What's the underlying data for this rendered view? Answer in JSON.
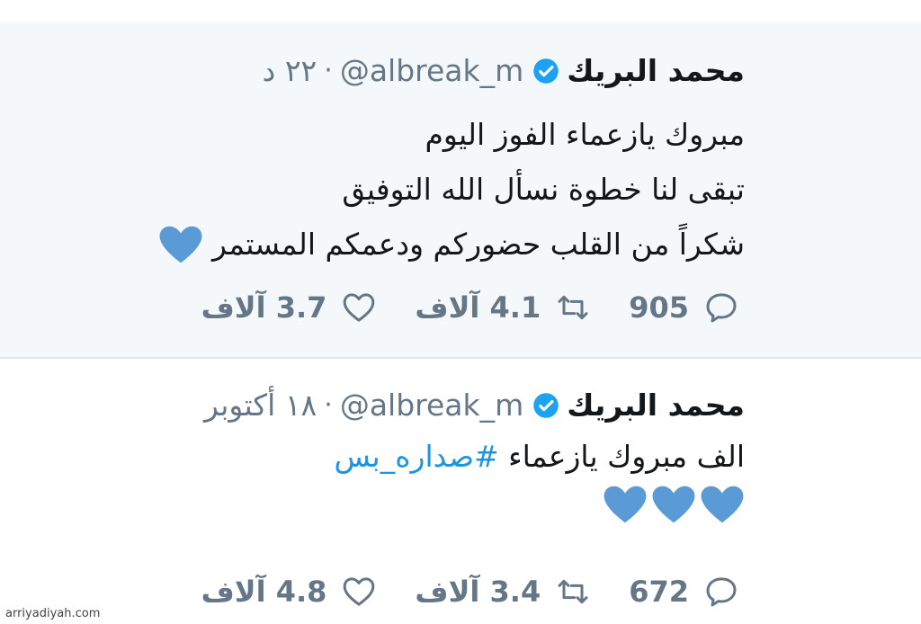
{
  "tweets": [
    {
      "name": "محمد البريك",
      "handle": "@albreak_m",
      "separator": "·",
      "time": "٢٢ د",
      "lines": [
        "مبروك يازعماء الفوز اليوم",
        "تبقى لنا خطوة نسأل الله التوفيق",
        "شكراً من القلب حضوركم ودعمكم المستمر"
      ],
      "replies": "905",
      "retweets": "4.1 آلاف",
      "likes": "3.7 آلاف"
    },
    {
      "name": "محمد البريك",
      "handle": "@albreak_m",
      "separator": "·",
      "time": "١٨ أكتوبر",
      "text": "الف مبروك يازعماء ",
      "hashtag": "#صداره_بس",
      "replies": "672",
      "retweets": "3.4 آلاف",
      "likes": "4.8 آلاف"
    }
  ],
  "watermark": "arriyadiyah.com",
  "colors": {
    "verified": "#1da1f2",
    "heart": "#5b9bd5",
    "hashtag": "#1b95e0",
    "muted": "#657786"
  },
  "icons": {
    "reply": "reply-icon",
    "retweet": "retweet-icon",
    "like": "like-icon",
    "verified": "verified-badge-icon",
    "heart": "blue-heart-emoji"
  }
}
